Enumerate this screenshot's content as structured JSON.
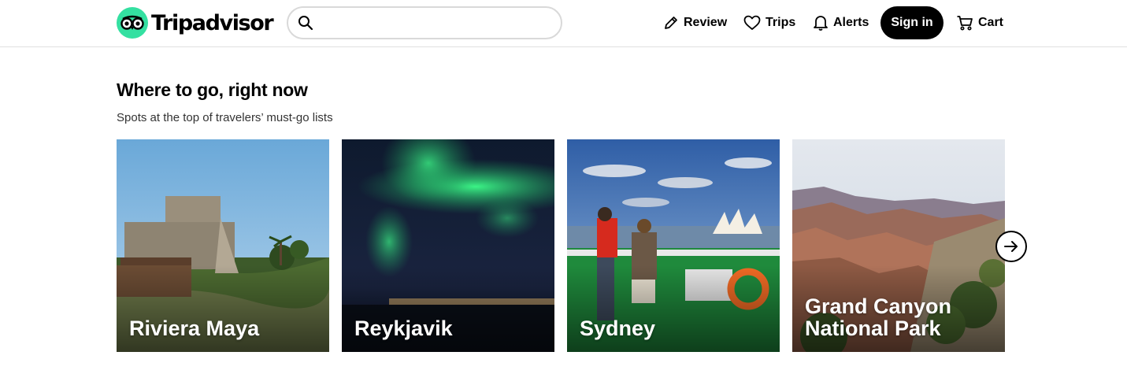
{
  "header": {
    "logo_text": "Tripadvisor",
    "search": {
      "placeholder": "",
      "value": ""
    },
    "nav": {
      "review": "Review",
      "trips": "Trips",
      "alerts": "Alerts",
      "sign_in": "Sign in",
      "cart": "Cart"
    }
  },
  "section": {
    "title": "Where to go, right now",
    "subtitle": "Spots at the top of travelers’ must-go lists"
  },
  "destinations": [
    {
      "name": "Riviera Maya"
    },
    {
      "name": "Reykjavik"
    },
    {
      "name": "Sydney"
    },
    {
      "name": "Grand Canyon National Park"
    }
  ],
  "colors": {
    "brand": "#34e0a1",
    "signin_bg": "#000000"
  },
  "icons": [
    "owl-logo-icon",
    "search-icon",
    "pencil-icon",
    "heart-icon",
    "bell-icon",
    "cart-icon",
    "arrow-right-icon"
  ]
}
